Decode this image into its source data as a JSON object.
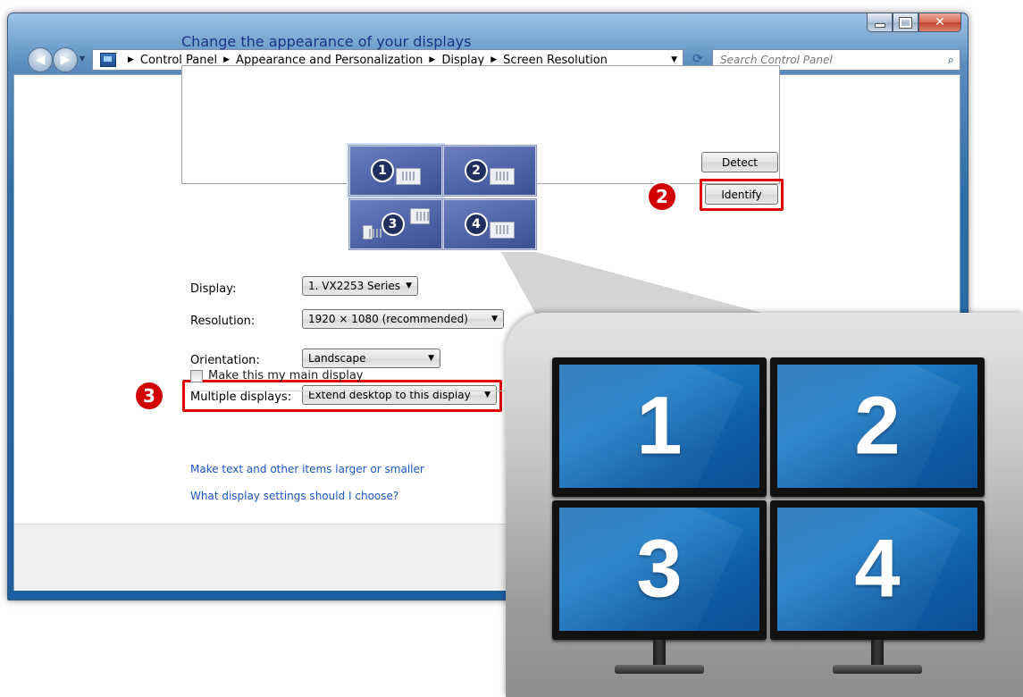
{
  "window": {
    "breadcrumbs": [
      "Control Panel",
      "Appearance and Personalization",
      "Display",
      "Screen Resolution"
    ],
    "search_placeholder": "Search Control Panel"
  },
  "content": {
    "title": "Change the appearance of your displays",
    "monitors": [
      "1",
      "2",
      "3",
      "4"
    ],
    "detect_label": "Detect",
    "identify_label": "Identify",
    "display_label": "Display:",
    "display_value": "1. VX2253 Series",
    "resolution_label": "Resolution:",
    "resolution_value": "1920 × 1080 (recommended)",
    "orientation_label": "Orientation:",
    "orientation_value": "Landscape",
    "multiple_label": "Multiple displays:",
    "multiple_value": "Extend desktop to this display",
    "main_display_label": "Make this my main display",
    "link_text_size": "Make text and other items larger or smaller",
    "link_settings": "What display settings should I choose?"
  },
  "callouts": {
    "step2": "2",
    "step3": "3"
  },
  "big_monitors": [
    "1",
    "2",
    "3",
    "4"
  ],
  "colors": {
    "highlight_red": "#e00000",
    "link_blue": "#1b55c0",
    "title_blue": "#1e3287"
  }
}
